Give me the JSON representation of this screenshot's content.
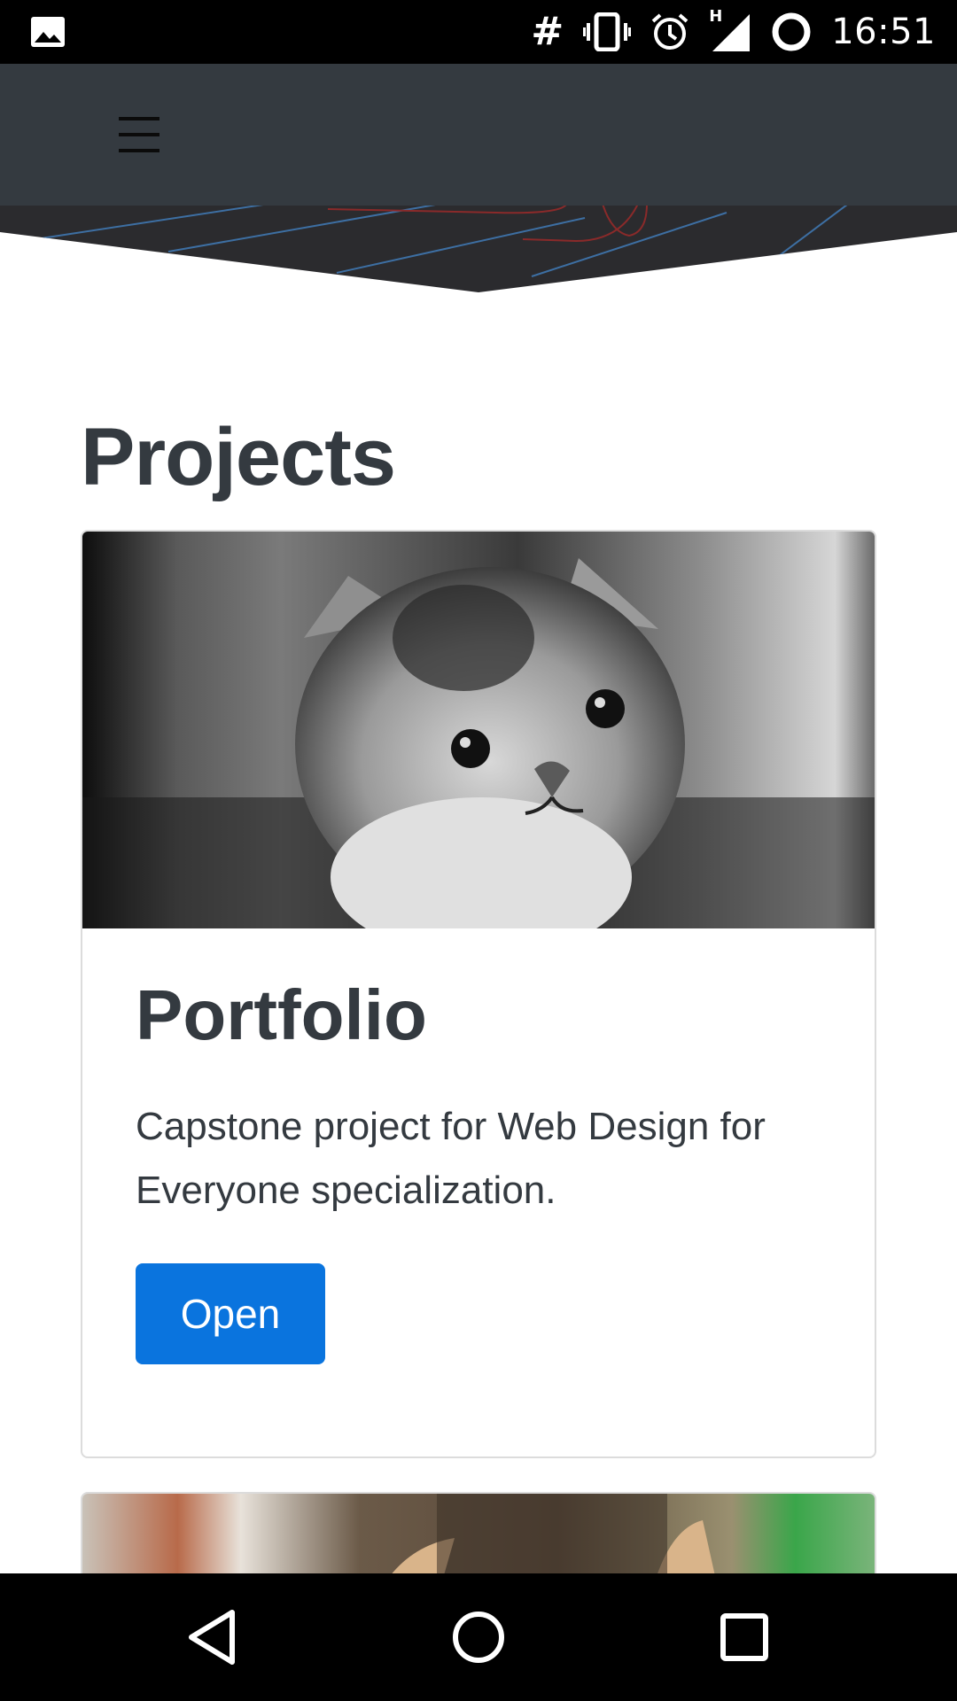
{
  "status_bar": {
    "time": "16:51",
    "carrier_symbol": "#",
    "network_type": "H",
    "icons": [
      "gallery-icon",
      "hash-icon",
      "vibrate-icon",
      "alarm-icon",
      "signal-icon",
      "sync-circle-icon"
    ]
  },
  "navbar": {
    "menu_icon": "hamburger-menu-icon",
    "background_color": "#343a40"
  },
  "main": {
    "section_title": "Projects",
    "cards": [
      {
        "title": "Portfolio",
        "text": "Capstone project for Web Design for Everyone specialization.",
        "button_label": "Open",
        "button_color": "#0a74de"
      }
    ]
  },
  "system_nav": {
    "buttons": [
      "back-icon",
      "home-icon",
      "recents-icon"
    ]
  }
}
